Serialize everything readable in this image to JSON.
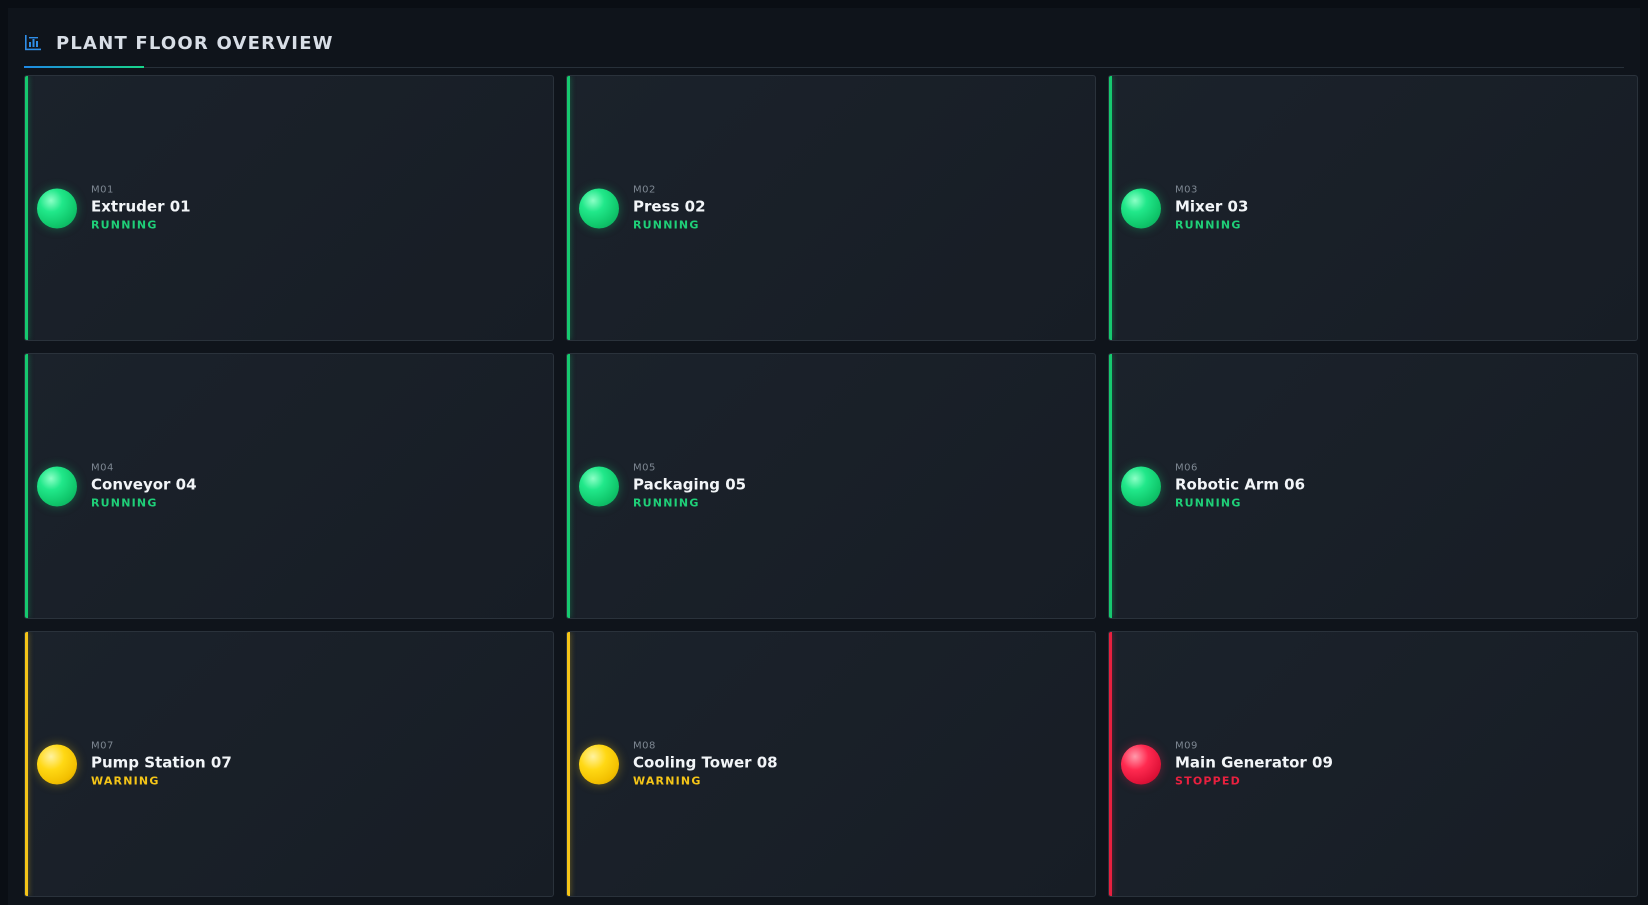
{
  "header": {
    "title": "PLANT FLOOR OVERVIEW",
    "icon": "bar-chart-icon"
  },
  "colors": {
    "running": "#16c96f",
    "warning": "#f5c518",
    "stopped": "#e8203f",
    "accent": "#1e88e5"
  },
  "machines": [
    {
      "id": "M01",
      "name": "Extruder 01",
      "status": "RUNNING"
    },
    {
      "id": "M02",
      "name": "Press 02",
      "status": "RUNNING"
    },
    {
      "id": "M03",
      "name": "Mixer 03",
      "status": "RUNNING"
    },
    {
      "id": "M04",
      "name": "Conveyor 04",
      "status": "RUNNING"
    },
    {
      "id": "M05",
      "name": "Packaging 05",
      "status": "RUNNING"
    },
    {
      "id": "M06",
      "name": "Robotic Arm 06",
      "status": "RUNNING"
    },
    {
      "id": "M07",
      "name": "Pump Station 07",
      "status": "WARNING"
    },
    {
      "id": "M08",
      "name": "Cooling Tower 08",
      "status": "WARNING"
    },
    {
      "id": "M09",
      "name": "Main Generator 09",
      "status": "STOPPED"
    }
  ]
}
